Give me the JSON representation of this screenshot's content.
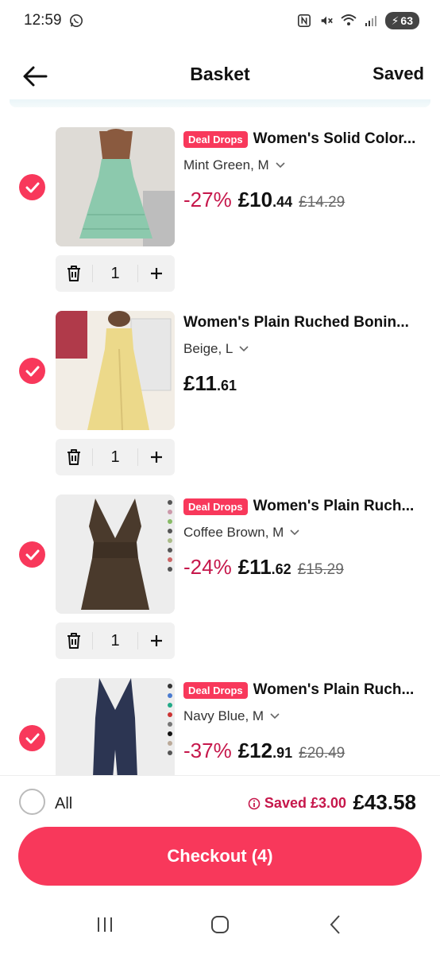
{
  "status_bar": {
    "time": "12:59",
    "battery": "63",
    "icons": [
      "whatsapp-icon",
      "nfc-icon",
      "mute-icon",
      "wifi-icon",
      "signal-icon",
      "battery-icon"
    ]
  },
  "header": {
    "title": "Basket",
    "saved_label": "Saved",
    "back_icon": "arrow-left-icon"
  },
  "cart": {
    "items": [
      {
        "badge": "Deal Drops",
        "title": "Women's Solid Color...",
        "variant": "Mint Green, M",
        "discount": "-27%",
        "price_main": "£10",
        "price_cents": ".44",
        "price_old": "£14.29",
        "quantity": "1",
        "selected": true,
        "image_color": "#8cc9ad"
      },
      {
        "badge": "",
        "title": "Women's Plain Ruched Bonin...",
        "variant": "Beige, L",
        "discount": "",
        "price_main": "£11",
        "price_cents": ".61",
        "price_old": "",
        "quantity": "1",
        "selected": true,
        "image_color": "#ecd98a"
      },
      {
        "badge": "Deal Drops",
        "title": "Women's Plain Ruch...",
        "variant": "Coffee Brown, M",
        "discount": "-24%",
        "price_main": "£11",
        "price_cents": ".62",
        "price_old": "£15.29",
        "quantity": "1",
        "selected": true,
        "image_color": "#4a3a2c"
      },
      {
        "badge": "Deal Drops",
        "title": "Women's Plain Ruch...",
        "variant": "Navy Blue, M",
        "discount": "-37%",
        "price_main": "£12",
        "price_cents": ".91",
        "price_old": "£20.49",
        "quantity": "1",
        "selected": true,
        "image_color": "#2c3552"
      }
    ]
  },
  "footer": {
    "all_label": "All",
    "saved_text": "Saved £3.00",
    "total": "£43.58",
    "checkout_label": "Checkout (4)"
  },
  "colors": {
    "accent": "#f8385b",
    "discount": "#c6174b"
  }
}
